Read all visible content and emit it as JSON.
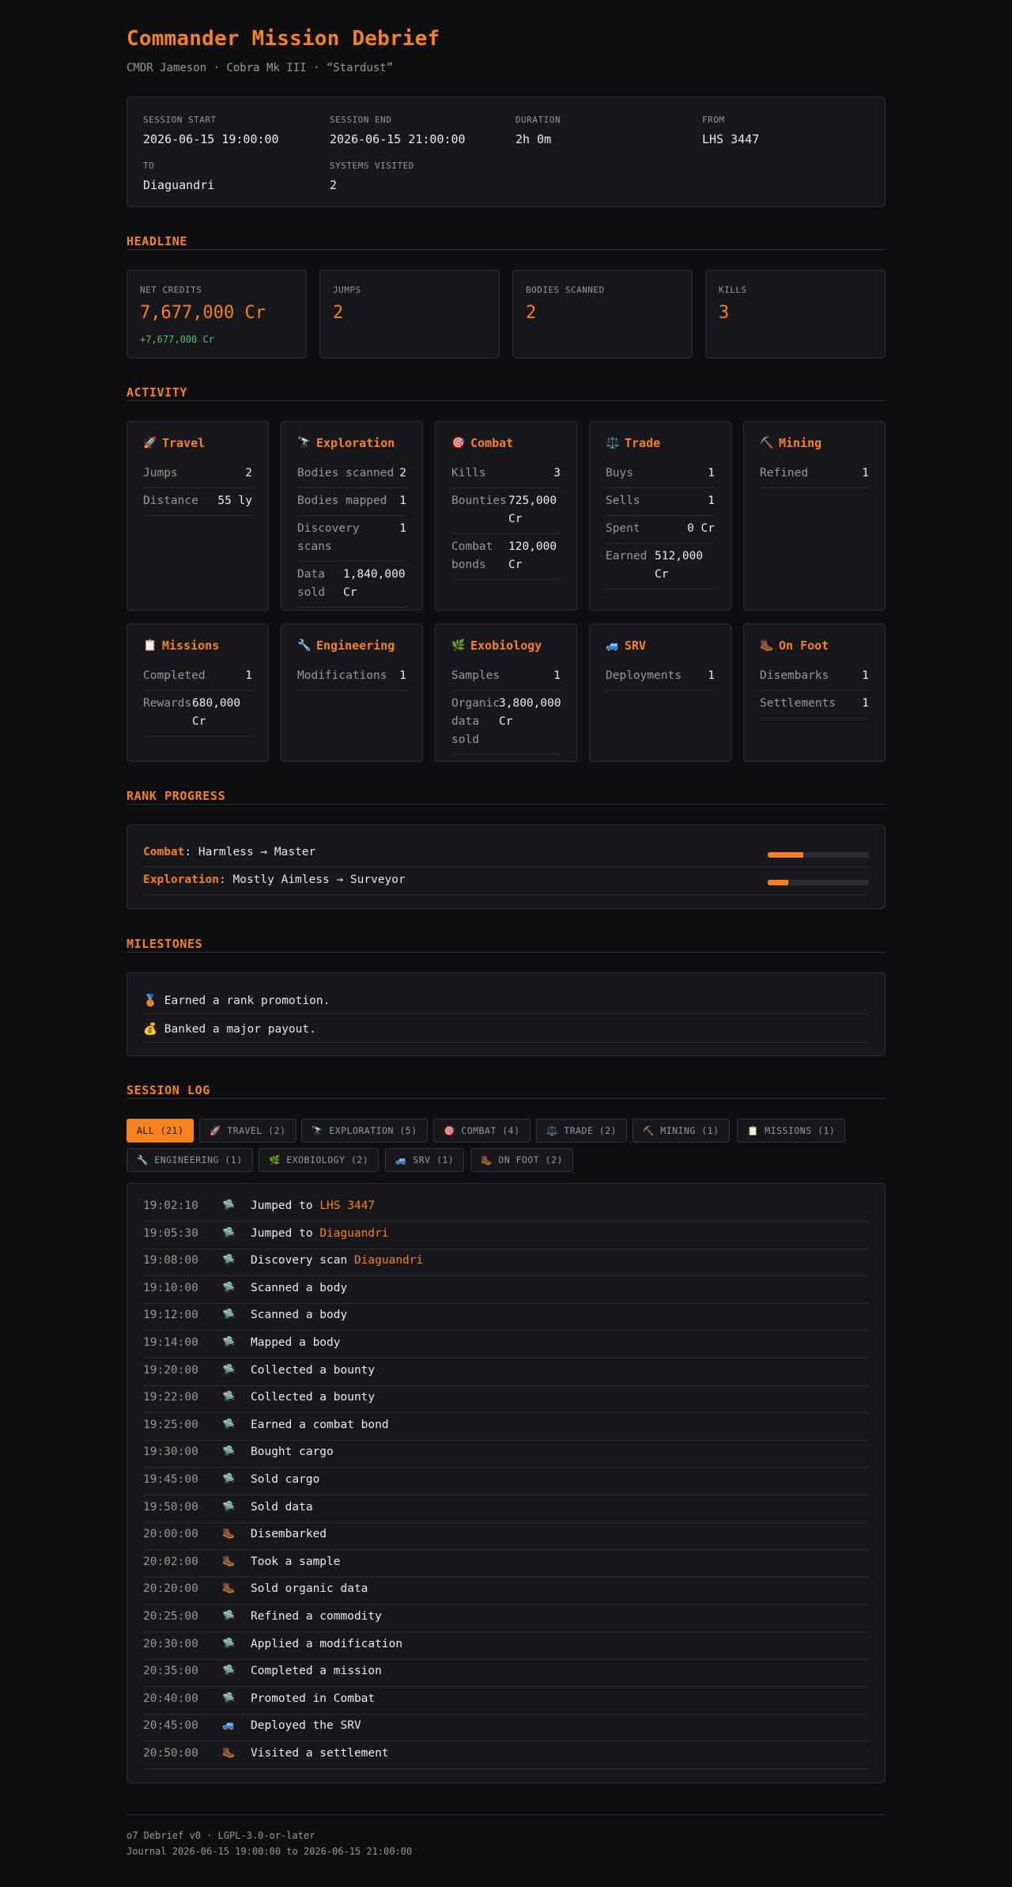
{
  "header": {
    "title": "Commander Mission Debrief",
    "subtitle": "CMDR Jameson · Cobra Mk III · “Stardust”"
  },
  "meta": [
    {
      "label": "SESSION START",
      "value": "2026-06-15 19:00:00"
    },
    {
      "label": "SESSION END",
      "value": "2026-06-15 21:00:00"
    },
    {
      "label": "DURATION",
      "value": "2h 0m"
    },
    {
      "label": "FROM",
      "value": "LHS 3447"
    },
    {
      "label": "TO",
      "value": "Diaguandri"
    },
    {
      "label": "SYSTEMS VISITED",
      "value": "2"
    }
  ],
  "sections": {
    "headline": "HEADLINE",
    "activity": "ACTIVITY",
    "rank": "RANK PROGRESS",
    "milestones": "MILESTONES",
    "log": "SESSION LOG"
  },
  "headline": [
    {
      "label": "NET CREDITS",
      "value": "7,677,000 Cr",
      "delta": "+7,677,000 Cr"
    },
    {
      "label": "JUMPS",
      "value": "2"
    },
    {
      "label": "BODIES SCANNED",
      "value": "2"
    },
    {
      "label": "KILLS",
      "value": "3"
    }
  ],
  "activity": [
    {
      "icon": "rocket-icon",
      "glyph": "🚀",
      "title": "Travel",
      "rows": [
        {
          "k": "Jumps",
          "v": "2"
        },
        {
          "k": "Distance",
          "v": "55 ly"
        }
      ]
    },
    {
      "icon": "telescope-icon",
      "glyph": "🔭",
      "title": "Exploration",
      "rows": [
        {
          "k": "Bodies scanned",
          "v": "2"
        },
        {
          "k": "Bodies mapped",
          "v": "1"
        },
        {
          "k": "Discovery scans",
          "v": "1"
        },
        {
          "k": "Data sold",
          "v": "1,840,000 Cr"
        }
      ]
    },
    {
      "icon": "target-icon",
      "glyph": "🎯",
      "title": "Combat",
      "rows": [
        {
          "k": "Kills",
          "v": "3"
        },
        {
          "k": "Bounties",
          "v": "725,000 Cr"
        },
        {
          "k": "Combat bonds",
          "v": "120,000 Cr"
        }
      ]
    },
    {
      "icon": "scales-icon",
      "glyph": "⚖️",
      "title": "Trade",
      "rows": [
        {
          "k": "Buys",
          "v": "1"
        },
        {
          "k": "Sells",
          "v": "1"
        },
        {
          "k": "Spent",
          "v": "0 Cr"
        },
        {
          "k": "Earned",
          "v": "512,000 Cr"
        }
      ]
    },
    {
      "icon": "pickaxe-icon",
      "glyph": "⛏️",
      "title": "Mining",
      "rows": [
        {
          "k": "Refined",
          "v": "1"
        }
      ]
    },
    {
      "icon": "clipboard-icon",
      "glyph": "📋",
      "title": "Missions",
      "rows": [
        {
          "k": "Completed",
          "v": "1"
        },
        {
          "k": "Rewards",
          "v": "680,000 Cr"
        }
      ]
    },
    {
      "icon": "wrench-icon",
      "glyph": "🔧",
      "title": "Engineering",
      "rows": [
        {
          "k": "Modifications",
          "v": "1"
        }
      ]
    },
    {
      "icon": "leaf-icon",
      "glyph": "🌿",
      "title": "Exobiology",
      "rows": [
        {
          "k": "Samples",
          "v": "1"
        },
        {
          "k": "Organic data sold",
          "v": "3,800,000 Cr"
        }
      ]
    },
    {
      "icon": "rover-icon",
      "glyph": "🚙",
      "title": "SRV",
      "rows": [
        {
          "k": "Deployments",
          "v": "1"
        }
      ]
    },
    {
      "icon": "boot-icon",
      "glyph": "🥾",
      "title": "On Foot",
      "rows": [
        {
          "k": "Disembarks",
          "v": "1"
        },
        {
          "k": "Settlements",
          "v": "1"
        }
      ]
    }
  ],
  "ranks": [
    {
      "label": "Combat",
      "text": ": Harmless → Master",
      "progress": 0.35
    },
    {
      "label": "Exploration",
      "text": ": Mostly Aimless → Surveyor",
      "progress": 0.2
    }
  ],
  "milestones": [
    {
      "icon": "medal-icon",
      "glyph": "🥉",
      "text": "Earned a rank promotion."
    },
    {
      "icon": "money-bag-icon",
      "glyph": "💰",
      "text": "Banked a major payout."
    }
  ],
  "filters": [
    {
      "label": "ALL (21)",
      "active": true
    },
    {
      "glyph": "🚀",
      "label": "TRAVEL (2)"
    },
    {
      "glyph": "🔭",
      "label": "EXPLORATION (5)"
    },
    {
      "glyph": "🎯",
      "label": "COMBAT (4)"
    },
    {
      "glyph": "⚖️",
      "label": "TRADE (2)"
    },
    {
      "glyph": "⛏️",
      "label": "MINING (1)"
    },
    {
      "glyph": "📋",
      "label": "MISSIONS (1)"
    },
    {
      "glyph": "🔧",
      "label": "ENGINEERING (1)"
    },
    {
      "glyph": "🌿",
      "label": "EXOBIOLOGY (2)"
    },
    {
      "glyph": "🚙",
      "label": "SRV (1)"
    },
    {
      "glyph": "🥾",
      "label": "ON FOOT (2)"
    }
  ],
  "log": [
    {
      "time": "19:02:10",
      "glyph": "🛸",
      "text": "Jumped to ",
      "hl": "LHS 3447"
    },
    {
      "time": "19:05:30",
      "glyph": "🛸",
      "text": "Jumped to ",
      "hl": "Diaguandri"
    },
    {
      "time": "19:08:00",
      "glyph": "🛸",
      "text": "Discovery scan ",
      "hl": "Diaguandri"
    },
    {
      "time": "19:10:00",
      "glyph": "🛸",
      "text": "Scanned a body"
    },
    {
      "time": "19:12:00",
      "glyph": "🛸",
      "text": "Scanned a body"
    },
    {
      "time": "19:14:00",
      "glyph": "🛸",
      "text": "Mapped a body"
    },
    {
      "time": "19:20:00",
      "glyph": "🛸",
      "text": "Collected a bounty"
    },
    {
      "time": "19:22:00",
      "glyph": "🛸",
      "text": "Collected a bounty"
    },
    {
      "time": "19:25:00",
      "glyph": "🛸",
      "text": "Earned a combat bond"
    },
    {
      "time": "19:30:00",
      "glyph": "🛸",
      "text": "Bought cargo"
    },
    {
      "time": "19:45:00",
      "glyph": "🛸",
      "text": "Sold cargo"
    },
    {
      "time": "19:50:00",
      "glyph": "🛸",
      "text": "Sold data"
    },
    {
      "time": "20:00:00",
      "glyph": "🥾",
      "text": "Disembarked"
    },
    {
      "time": "20:02:00",
      "glyph": "🥾",
      "text": "Took a sample"
    },
    {
      "time": "20:20:00",
      "glyph": "🥾",
      "text": "Sold organic data"
    },
    {
      "time": "20:25:00",
      "glyph": "🛸",
      "text": "Refined a commodity"
    },
    {
      "time": "20:30:00",
      "glyph": "🛸",
      "text": "Applied a modification"
    },
    {
      "time": "20:35:00",
      "glyph": "🛸",
      "text": "Completed a mission"
    },
    {
      "time": "20:40:00",
      "glyph": "🛸",
      "text": "Promoted in Combat"
    },
    {
      "time": "20:45:00",
      "glyph": "🚙",
      "text": "Deployed the SRV"
    },
    {
      "time": "20:50:00",
      "glyph": "🥾",
      "text": "Visited a settlement"
    }
  ],
  "footer": {
    "line1": "o7 Debrief v0 · LGPL-3.0-or-later",
    "line2": "Journal 2026-06-15 19:00:00 to 2026-06-15 21:00:00"
  },
  "colors": {
    "accent": "#f5821f",
    "positive": "#4cc26a",
    "background": "#0f0f11",
    "panel": "#18181c"
  }
}
